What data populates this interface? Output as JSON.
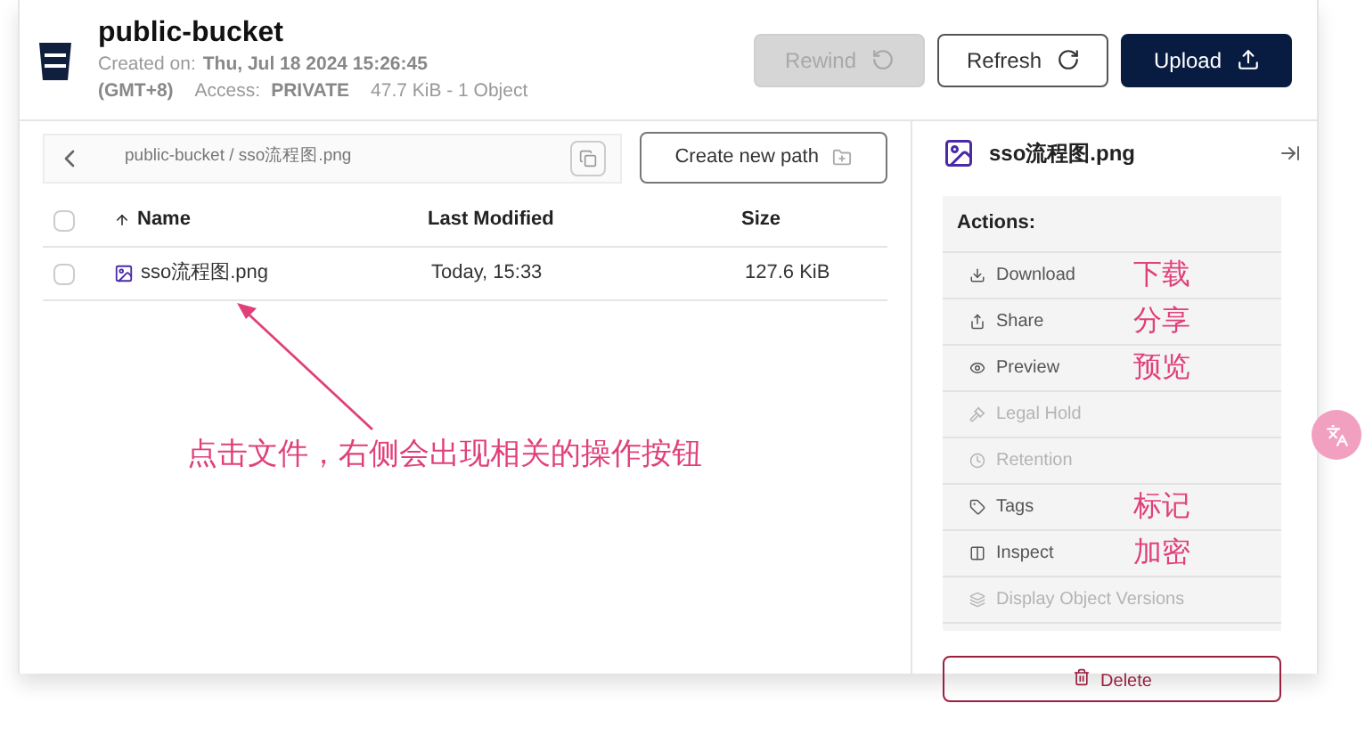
{
  "bucket": {
    "title": "public-bucket",
    "created_label": "Created on:",
    "created": "Thu, Jul 18 2024 15:26:45",
    "timezone": "(GMT+8)",
    "access_label": "Access:",
    "access": "PRIVATE",
    "usage": "47.7 KiB - 1 Object"
  },
  "header_buttons": [
    {
      "label": "Rewind",
      "kind": "rewind",
      "disabled": true
    },
    {
      "label": "Refresh",
      "kind": "refresh",
      "disabled": false
    },
    {
      "label": "Upload",
      "kind": "upload",
      "disabled": false
    }
  ],
  "path": "public-bucket / sso流程图.png",
  "create_path": "Create new path",
  "table": {
    "all_checked": false,
    "columns": [
      "Name",
      "Last Modified",
      "Size"
    ],
    "rows": [
      {
        "name": "sso流程图.png",
        "modified": "Today, 15:33",
        "size": "127.6 KiB",
        "checked": false
      }
    ]
  },
  "annotation": "点击文件，右侧会出现相关的操作按钮",
  "panel": {
    "file": "sso流程图.png",
    "actions_title": "Actions:",
    "actions": [
      {
        "label": "Download",
        "kind": "download",
        "disabled": false,
        "note": "下载"
      },
      {
        "label": "Share",
        "kind": "share",
        "disabled": false,
        "note": "分享"
      },
      {
        "label": "Preview",
        "kind": "preview",
        "disabled": false,
        "note": "预览"
      },
      {
        "label": "Legal Hold",
        "kind": "legal",
        "disabled": true
      },
      {
        "label": "Retention",
        "kind": "retention",
        "disabled": true
      },
      {
        "label": "Tags",
        "kind": "tags",
        "disabled": false,
        "note": "标记"
      },
      {
        "label": "Inspect",
        "kind": "inspect",
        "disabled": false,
        "note": "加密"
      },
      {
        "label": "Display Object Versions",
        "kind": "versions",
        "disabled": true
      }
    ],
    "delete": "Delete"
  }
}
